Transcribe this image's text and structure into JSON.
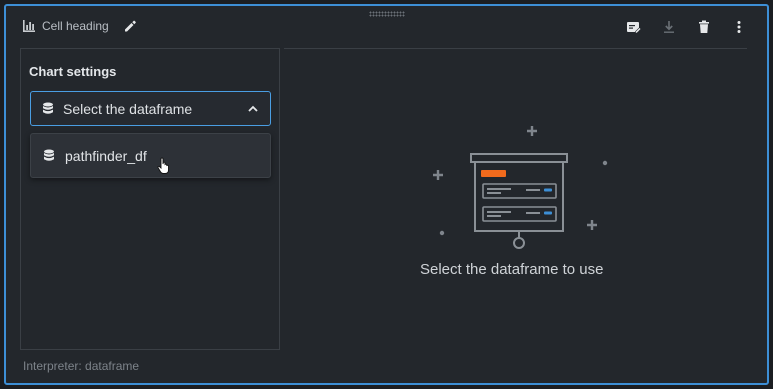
{
  "header": {
    "title": "Cell heading",
    "icons": [
      "bar-chart-icon",
      "pencil-icon",
      "edit-note-icon",
      "download-icon",
      "trash-icon",
      "more-vertical-icon"
    ]
  },
  "settings": {
    "title": "Chart settings",
    "select": {
      "placeholder": "Select the dataframe",
      "icon": "database-icon",
      "state": "open"
    },
    "options": [
      {
        "label": "pathfinder_df",
        "icon": "database-icon"
      }
    ]
  },
  "empty_state": {
    "message": "Select the dataframe to use"
  },
  "footer": {
    "interpreter": "Interpreter: dataframe"
  },
  "colors": {
    "accent": "#3d8fd6",
    "highlight": "#f26b1d",
    "background": "#23272c"
  }
}
